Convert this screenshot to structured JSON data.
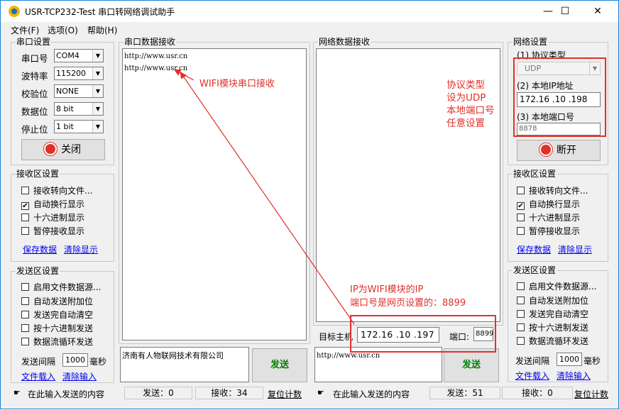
{
  "window": {
    "title": "USR-TCP232-Test 串口转网络调试助手",
    "minimize_glyph": "—",
    "maximize_glyph": "☐",
    "close_glyph": "✕"
  },
  "menu": [
    "文件(F)",
    "选项(O)",
    "帮助(H)"
  ],
  "serial_settings": {
    "group_label": "串口设置",
    "port_label": "串口号",
    "port_value": "COM4",
    "baud_label": "波特率",
    "baud_value": "115200",
    "parity_label": "校验位",
    "parity_value": "NONE",
    "databits_label": "数据位",
    "databits_value": "8 bit",
    "stopbits_label": "停止位",
    "stopbits_value": "1 bit",
    "close_button": "关闭"
  },
  "serial_recv_settings": {
    "group_label": "接收区设置",
    "options": [
      "接收转向文件...",
      "自动换行显示",
      "十六进制显示",
      "暂停接收显示"
    ],
    "checked": [
      false,
      true,
      false,
      false
    ],
    "save_link": "保存数据",
    "clear_link": "清除显示"
  },
  "serial_send_settings": {
    "group_label": "发送区设置",
    "options": [
      "启用文件数据源...",
      "自动发送附加位",
      "发送完自动清空",
      "按十六进制发送",
      "数据流循环发送"
    ],
    "checked": [
      false,
      false,
      false,
      false,
      false
    ],
    "interval_label": "发送间隔",
    "interval_value": "1000",
    "interval_unit": "毫秒",
    "load_link": "文件载入",
    "clear_link": "清除输入"
  },
  "serial_recv": {
    "label": "串口数据接收",
    "lines": [
      "http://www.usr.cn",
      "http://www.usr.cn"
    ]
  },
  "serial_send": {
    "text": "济南有人物联网技术有限公司",
    "send_button": "发送"
  },
  "net_recv": {
    "label": "网络数据接收"
  },
  "net_send": {
    "text": "http://www.usr.cn",
    "send_button": "发送"
  },
  "target": {
    "label": "目标主机",
    "ip": "172.16 .10 .197",
    "port_label": "端口:",
    "port": "8899"
  },
  "net_settings": {
    "group_label": "网络设置",
    "protocol_label": "(1) 协议类型",
    "protocol_value": "UDP",
    "ip_label": "(2) 本地IP地址",
    "ip_value": "172.16 .10 .198",
    "port_label": "(3) 本地端口号",
    "port_value": "8878",
    "open_button": "断开"
  },
  "net_recv_settings": {
    "group_label": "接收区设置",
    "options": [
      "接收转向文件...",
      "自动换行显示",
      "十六进制显示",
      "暂停接收显示"
    ],
    "checked": [
      false,
      true,
      false,
      false
    ],
    "save_link": "保存数据",
    "clear_link": "清除显示"
  },
  "net_send_settings": {
    "group_label": "发送区设置",
    "options": [
      "启用文件数据源...",
      "自动发送附加位",
      "发送完自动清空",
      "按十六进制发送",
      "数据流循环发送"
    ],
    "checked": [
      false,
      false,
      false,
      false,
      false
    ],
    "interval_label": "发送间隔",
    "interval_value": "1000",
    "interval_unit": "毫秒",
    "load_link": "文件载入",
    "clear_link": "清除输入"
  },
  "status_left": {
    "hint": "在此输入发送的内容",
    "send": "发送：0",
    "recv": "接收：34",
    "reset": "复位计数"
  },
  "status_right": {
    "hint": "在此输入发送的内容",
    "send": "发送：51",
    "recv": "接收：0",
    "reset": "复位计数"
  },
  "annotations": {
    "wifi_recv": "WIFI模块串口接收",
    "protocol_note": [
      "协议类型",
      "设为UDP",
      "本地端口号",
      "任意设置"
    ],
    "ip_note": [
      "IP为WIFI模块的IP",
      "端口号是网页设置的：8899"
    ]
  },
  "colors": {
    "annotation": "#e0302a",
    "link": "#0000ee",
    "send_text": "#008000"
  }
}
